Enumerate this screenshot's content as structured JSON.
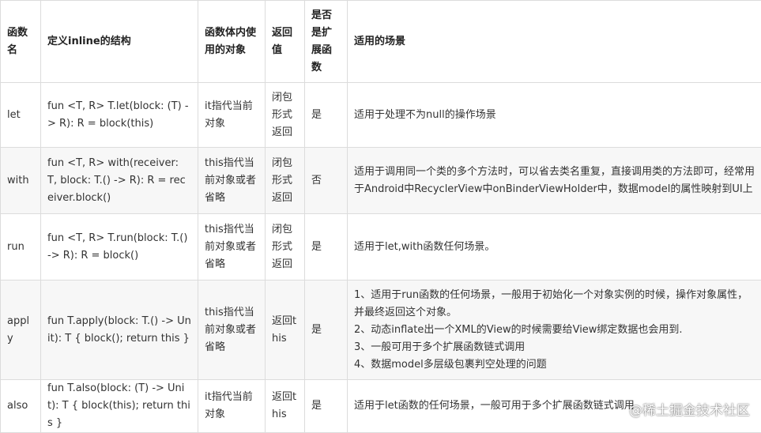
{
  "table": {
    "headers": [
      "函数名",
      "定义inline的结构",
      "函数体内使用的对象",
      "返回值",
      "是否是扩展函数",
      "适用的场景"
    ],
    "rows": [
      {
        "name": "let",
        "definition": "fun <T, R> T.let(block: (T) -> R): R = block(this)",
        "object": "it指代当前对象",
        "return": "闭包形式返回",
        "extension": "是",
        "scenario": [
          "适用于处理不为null的操作场景"
        ]
      },
      {
        "name": "with",
        "definition": "fun <T, R> with(receiver: T, block: T.() -> R): R = receiver.block()",
        "object": "this指代当前对象或者省略",
        "return": "闭包形式返回",
        "extension": "否",
        "scenario": [
          "适用于调用同一个类的多个方法时，可以省去类名重复，直接调用类的方法即可，经常用于Android中RecyclerView中onBinderViewHolder中，数据model的属性映射到UI上"
        ]
      },
      {
        "name": "run",
        "definition": "fun <T, R> T.run(block: T.() -> R): R = block()",
        "object": "this指代当前对象或者省略",
        "return": "闭包形式返回",
        "extension": "是",
        "scenario": [
          "适用于let,with函数任何场景。"
        ]
      },
      {
        "name": "apply",
        "definition": "fun T.apply(block: T.() -> Unit): T { block(); return this }",
        "object": "this指代当前对象或者省略",
        "return": "返回this",
        "extension": "是",
        "scenario": [
          "1、适用于run函数的任何场景，一般用于初始化一个对象实例的时候，操作对象属性，并最终返回这个对象。",
          "2、动态inflate出一个XML的View的时候需要给View绑定数据也会用到.",
          "3、一般可用于多个扩展函数链式调用",
          "4、数据model多层级包裹判空处理的问题"
        ]
      },
      {
        "name": "also",
        "definition": "fun T.also(block: (T) -> Unit): T { block(this); return this }",
        "object": "it指代当前对象",
        "return": "返回this",
        "extension": "是",
        "scenario": [
          "适用于let函数的任何场景，一般可用于多个扩展函数链式调用"
        ]
      }
    ]
  },
  "watermark": "@稀土掘金技术社区"
}
